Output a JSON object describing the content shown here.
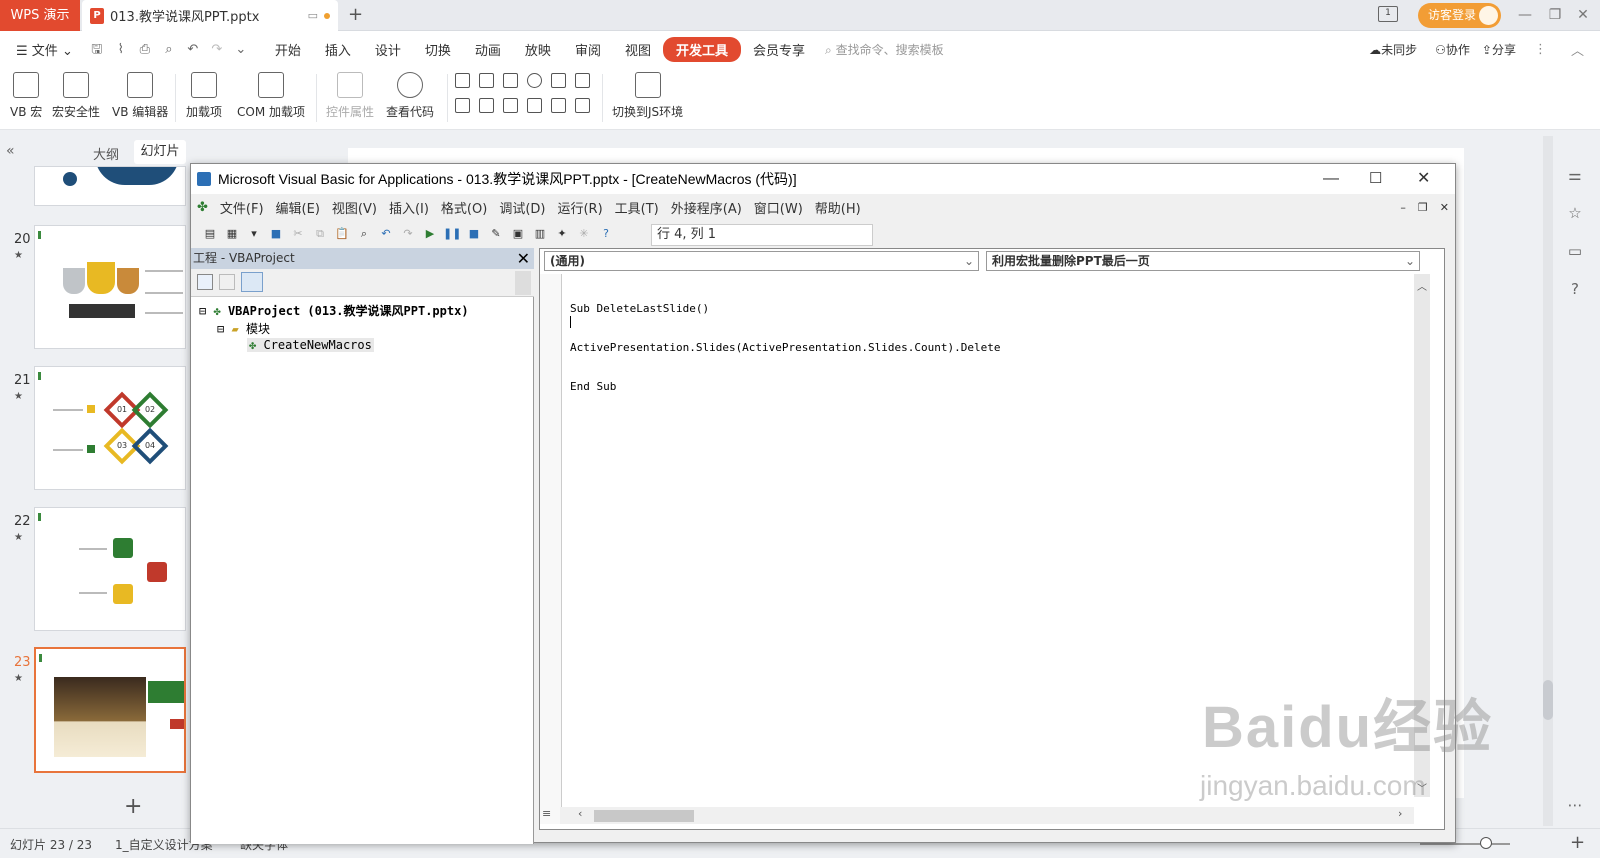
{
  "titlebar": {
    "app": "WPS 演示",
    "doc_tab": "013.教学说课风PPT.pptx",
    "login": "访客登录"
  },
  "menu": {
    "file": "文件",
    "tabs": [
      "开始",
      "插入",
      "设计",
      "切换",
      "动画",
      "放映",
      "审阅",
      "视图",
      "开发工具",
      "会员专享"
    ],
    "active_tab": "开发工具",
    "search": "查找命令、搜索模板",
    "sync": "未同步",
    "collab": "协作",
    "share": "分享"
  },
  "ribbon": {
    "vb_macro": "VB 宏",
    "macro_security": "宏安全性",
    "vb_editor": "VB 编辑器",
    "addins": "加载项",
    "com_addins": "COM 加载项",
    "control_props": "控件属性",
    "view_code": "查看代码",
    "switch_js": "切换到JS环境"
  },
  "panel": {
    "outline": "大纲",
    "slides": "幻灯片",
    "slide_numbers": [
      "20",
      "21",
      "22",
      "23"
    ],
    "star": "★",
    "add": "+"
  },
  "thumbs": {
    "s21": [
      "01",
      "02",
      "03",
      "04"
    ]
  },
  "status": {
    "slide_count": "幻灯片 23 / 23",
    "theme": "1_自定义设计方案",
    "font": "缺失字体"
  },
  "vba": {
    "title": "Microsoft Visual Basic for Applications - 013.教学说课风PPT.pptx - [CreateNewMacros (代码)]",
    "menus": [
      "文件(F)",
      "编辑(E)",
      "视图(V)",
      "插入(I)",
      "格式(O)",
      "调试(D)",
      "运行(R)",
      "工具(T)",
      "外接程序(A)",
      "窗口(W)",
      "帮助(H)"
    ],
    "position": "行 4, 列 1",
    "project_title": "工程 - VBAProject",
    "project_root": "VBAProject (013.教学说课风PPT.pptx)",
    "modules": "模块",
    "module_name": "CreateNewMacros",
    "combo_left": "(通用)",
    "combo_right": "利用宏批量删除PPT最后一页",
    "code": [
      "Sub DeleteLastSlide()",
      "ActivePresentation.Slides(ActivePresentation.Slides.Count).Delete",
      "End Sub"
    ]
  },
  "watermark": {
    "brand": "Baidu经验",
    "url": "jingyan.baidu.com"
  },
  "colors": {
    "accent": "#e24a2f",
    "login": "#f29d35",
    "selected_thumb": "#e8743b"
  }
}
